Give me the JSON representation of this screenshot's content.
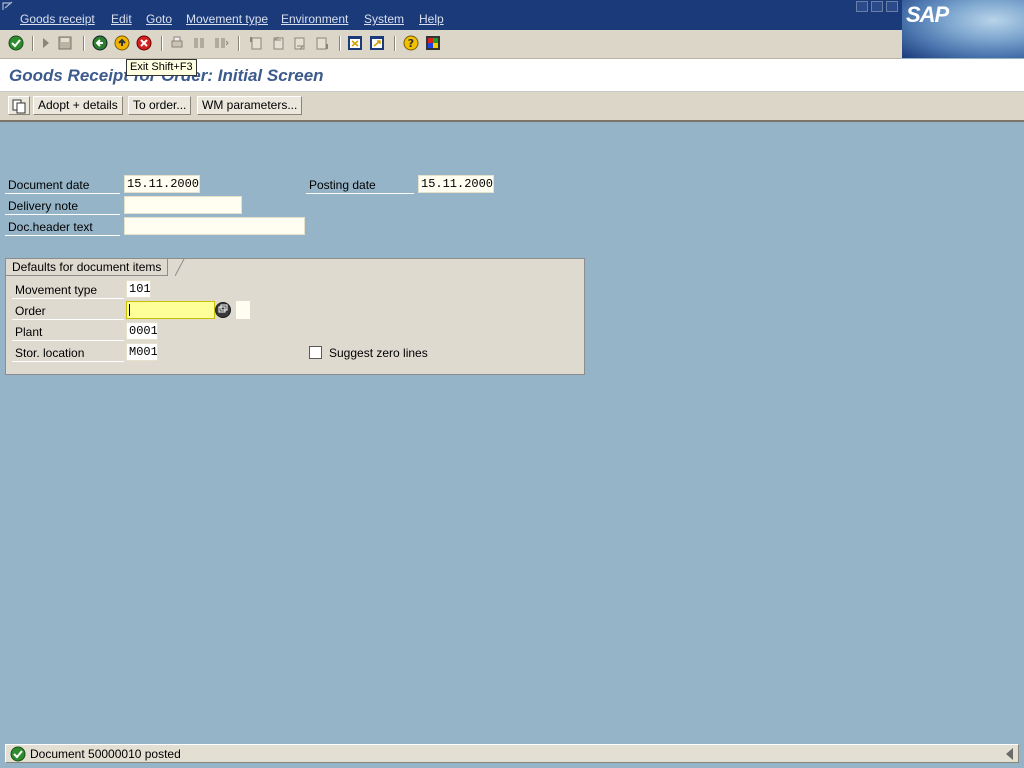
{
  "menubar": {
    "items": [
      "Goods receipt",
      "Edit",
      "Goto",
      "Movement type",
      "Environment",
      "System",
      "Help"
    ],
    "logo": "SAP"
  },
  "toolbar": {
    "icons": [
      "enter-icon",
      "command-field-icon",
      "save-icon",
      "back-icon",
      "exit-icon",
      "cancel-icon",
      "print-icon",
      "find-icon",
      "find-next-icon",
      "first-page-icon",
      "previous-page-icon",
      "next-page-icon",
      "last-page-icon",
      "create-session-icon",
      "create-shortcut-icon",
      "help-icon",
      "customize-layout-icon"
    ]
  },
  "tooltip": "Exit  Shift+F3",
  "title": "Goods Receipt for Order: Initial Screen",
  "app_toolbar": {
    "buttons": [
      "Adopt + details",
      "To order...",
      "WM parameters..."
    ]
  },
  "header_fields": {
    "document_date": {
      "label": "Document date",
      "value": "15.11.2000"
    },
    "posting_date": {
      "label": "Posting date",
      "value": "15.11.2000"
    },
    "delivery_note": {
      "label": "Delivery note",
      "value": ""
    },
    "doc_header_text": {
      "label": "Doc.header text",
      "value": ""
    }
  },
  "defaults_group": {
    "title": "Defaults for document items",
    "movement_type": {
      "label": "Movement type",
      "value": "101"
    },
    "order": {
      "label": "Order",
      "value": ""
    },
    "plant": {
      "label": "Plant",
      "value": "0001"
    },
    "stor_location": {
      "label": "Stor. location",
      "value": "M001"
    },
    "suggest_zero_lines": {
      "label": "Suggest zero lines",
      "checked": false
    }
  },
  "status": {
    "message": "Document 50000010 posted"
  },
  "colors": {
    "background": "#95b4c7",
    "menubar": "#1b3a7a",
    "title": "#3c5a8c",
    "required_field": "#ffff99"
  }
}
